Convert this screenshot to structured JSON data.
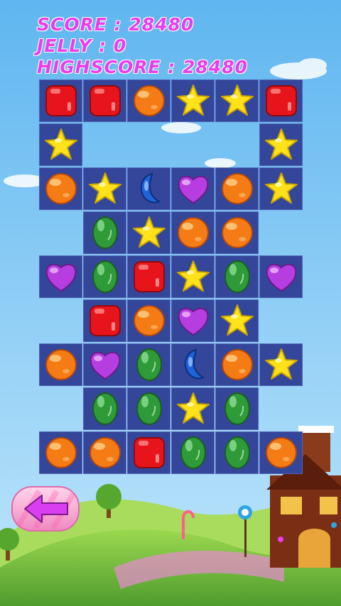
{
  "hud": {
    "score_line": "SCORE : 28480",
    "jelly_line": "JELLY : 0",
    "highscore_line": "HIGHSCORE : 28480"
  },
  "board": {
    "rows": [
      [
        "red-square",
        "red-square",
        "orange-round",
        "yellow-star",
        "yellow-star",
        "red-square"
      ],
      [
        "yellow-star",
        null,
        null,
        null,
        null,
        "yellow-star"
      ],
      [
        "orange-round",
        "yellow-star",
        "blue-bean",
        "purple-heart",
        "orange-round",
        "yellow-star"
      ],
      [
        null,
        "green-oval",
        "yellow-star",
        "orange-round",
        "orange-round",
        null
      ],
      [
        "purple-heart",
        "green-oval",
        "red-square",
        "yellow-star",
        "green-oval",
        "purple-heart"
      ],
      [
        null,
        "red-square",
        "orange-round",
        "purple-heart",
        "yellow-star",
        null
      ],
      [
        "orange-round",
        "purple-heart",
        "green-oval",
        "blue-bean",
        "orange-round",
        "yellow-star"
      ],
      [
        null,
        "green-oval",
        "green-oval",
        "yellow-star",
        "green-oval",
        null
      ],
      [
        "orange-round",
        "orange-round",
        "red-square",
        "green-oval",
        "green-oval",
        "orange-round"
      ]
    ]
  },
  "colors": {
    "hud_text": "#e83df0",
    "tile": "#34469a",
    "sky": "#7fc7f4",
    "hill": "#7cc243"
  },
  "icons": {
    "back": "left-arrow-icon"
  }
}
